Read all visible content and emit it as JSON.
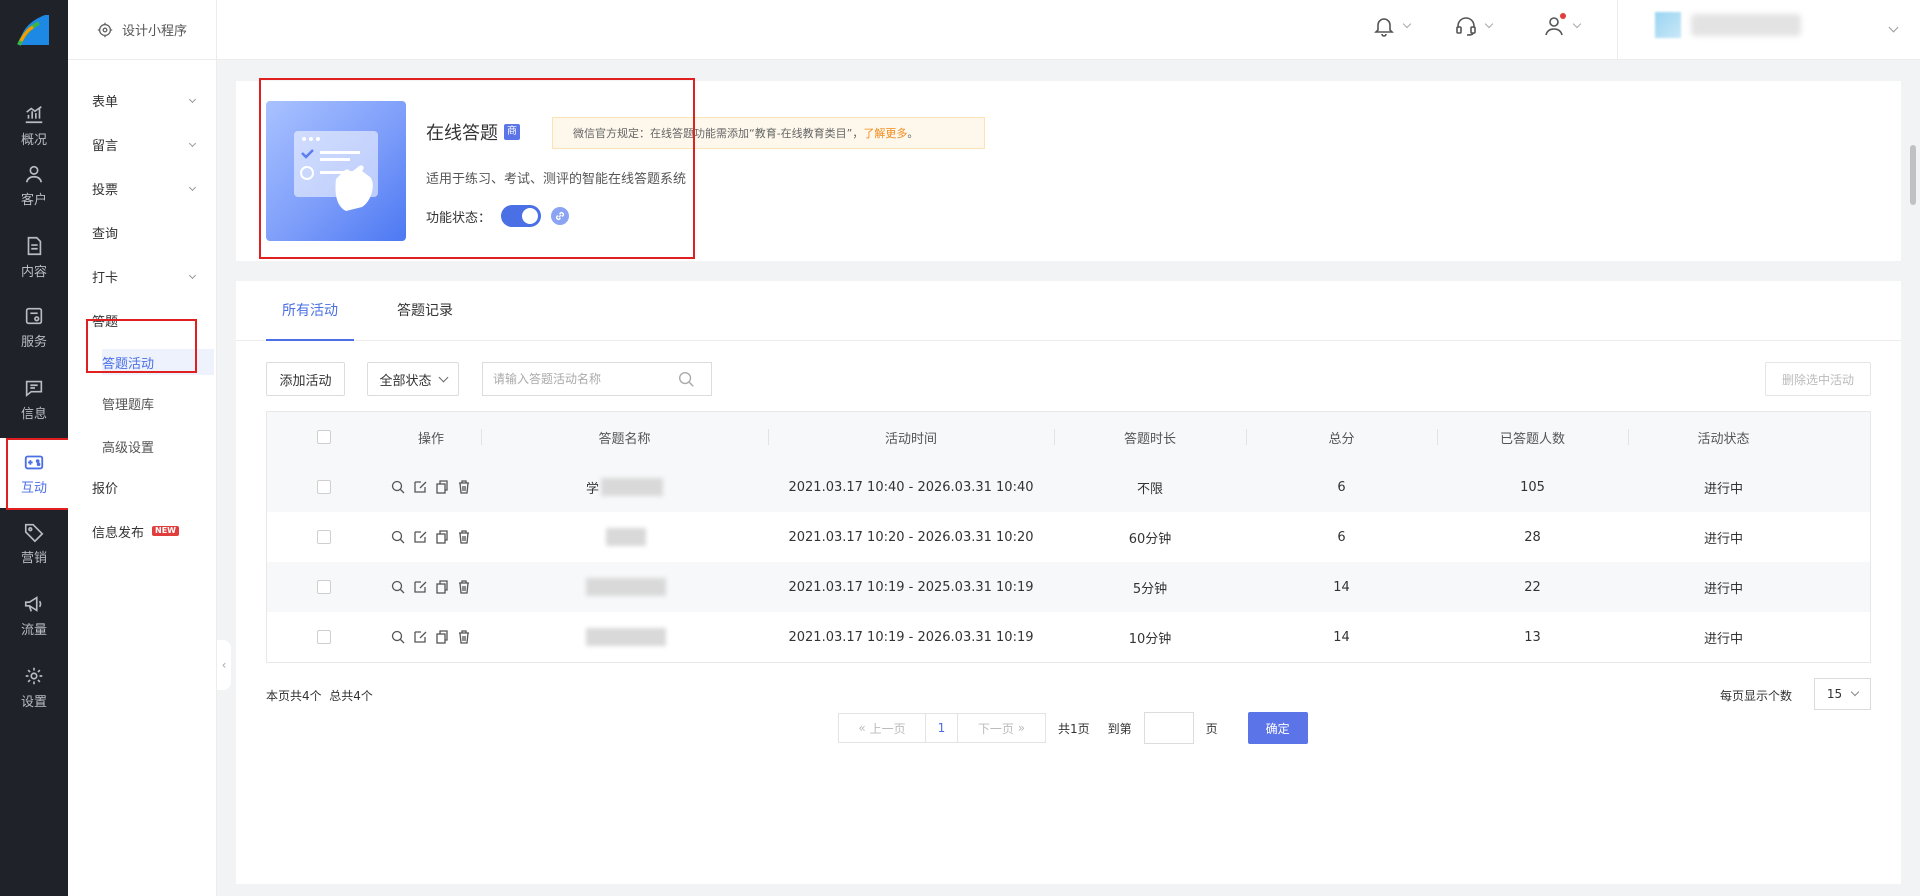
{
  "rail": {
    "items": [
      {
        "label": "概况",
        "icon": "chart-icon"
      },
      {
        "label": "客户",
        "icon": "user-icon"
      },
      {
        "label": "内容",
        "icon": "document-icon"
      },
      {
        "label": "服务",
        "icon": "service-icon"
      },
      {
        "label": "信息",
        "icon": "message-icon"
      },
      {
        "label": "互动",
        "icon": "gamepad-icon"
      },
      {
        "label": "营销",
        "icon": "tag-icon"
      },
      {
        "label": "流量",
        "icon": "megaphone-icon"
      },
      {
        "label": "设置",
        "icon": "gear-icon"
      }
    ],
    "active_index": 5
  },
  "subnav": {
    "brand": "设计小程序",
    "items": [
      "表单",
      "留言",
      "投票",
      "查询",
      "打卡",
      "答题",
      "报价",
      "信息发布"
    ],
    "children": [
      "答题活动",
      "管理题库",
      "高级设置"
    ],
    "active_child": "答题活动",
    "new_badge": "NEW"
  },
  "feature": {
    "title": "在线答题",
    "badge": "商",
    "notice_text": "微信官方规定：在线答题功能需添加“教育-在线教育类目”，",
    "notice_link": "了解更多",
    "notice_end": "。",
    "desc": "适用于练习、考试、测评的智能在线答题系统",
    "status_label": "功能状态：",
    "enabled": true
  },
  "tabs": [
    "所有活动",
    "答题记录"
  ],
  "toolbar": {
    "add_label": "添加活动",
    "status_filter": "全部状态",
    "search_placeholder": "请输入答题活动名称",
    "delete_label": "删除选中活动"
  },
  "table": {
    "headers": [
      "操作",
      "答题名称",
      "活动时间",
      "答题时长",
      "总分",
      "已答题人数",
      "活动状态"
    ],
    "rows": [
      {
        "name": "学",
        "time": "2021.03.17 10:40 - 2026.03.31 10:40",
        "duration": "不限",
        "score": "6",
        "count": "105",
        "status": "进行中"
      },
      {
        "name": "",
        "time": "2021.03.17 10:20 - 2026.03.31 10:20",
        "duration": "60分钟",
        "score": "6",
        "count": "28",
        "status": "进行中"
      },
      {
        "name": "",
        "time": "2021.03.17 10:19 - 2025.03.31 10:19",
        "duration": "5分钟",
        "score": "14",
        "count": "22",
        "status": "进行中"
      },
      {
        "name": "",
        "time": "2021.03.17 10:19 - 2026.03.31 10:19",
        "duration": "10分钟",
        "score": "14",
        "count": "13",
        "status": "进行中"
      }
    ]
  },
  "footer": {
    "summary_page": "本页共4个",
    "summary_total": "总共4个",
    "per_page_label": "每页显示个数",
    "per_page": "15"
  },
  "pager": {
    "prev": "上一页",
    "current": "1",
    "next": "下一页",
    "total_pages": "共1页",
    "goto_label": "到第",
    "page_unit": "页",
    "confirm": "确定"
  },
  "colors": {
    "accent": "#4b6fe4",
    "annotation": "#e02020",
    "rail_bg": "#1f2228"
  }
}
